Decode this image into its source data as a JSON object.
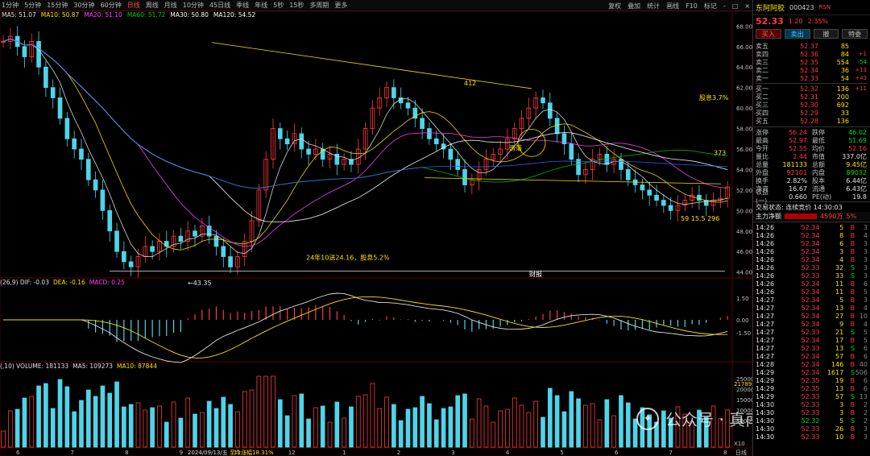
{
  "toolbar": {
    "periods": [
      "1分钟",
      "5分钟",
      "15分钟",
      "30分钟",
      "60分钟",
      "日线",
      "周线",
      "月线",
      "10分钟",
      "45日线",
      "季线",
      "年线",
      "5秒",
      "15秒",
      "多周期",
      "更多"
    ],
    "active_period": "日线",
    "right": [
      "复权",
      "叠加",
      "统计",
      "画线",
      "F10",
      "标记",
      "-",
      "□",
      "×"
    ]
  },
  "ma_legend": [
    {
      "text": "MA5: 51.07",
      "color": "#e0e0e0"
    },
    {
      "text": "MA10: 50.87",
      "color": "#ffe000"
    },
    {
      "text": "MA20: 51.10",
      "color": "#ff40ff"
    },
    {
      "text": "MA60: 51.72",
      "color": "#00d000"
    },
    {
      "text": "MA30: 50.80",
      "color": "#ffffff"
    },
    {
      "text": "MA120: 54.52",
      "color": "#ffffff"
    }
  ],
  "macd_legend": [
    {
      "text": "(26,9) DIF: -0.03",
      "color": "#e0e0e0"
    },
    {
      "text": "DEA: -0.16",
      "color": "#ffe000"
    },
    {
      "text": "MACD: 0.25",
      "color": "#ff40ff"
    }
  ],
  "vol_legend": [
    {
      "text": "(,10) VOLUME: 181133",
      "color": "#e0e0e0"
    },
    {
      "text": "MA5: 109273",
      "color": "#e0e0e0"
    },
    {
      "text": "MA10: 87844",
      "color": "#ffe000"
    }
  ],
  "chart_data": {
    "type": "candlestick",
    "price_axis": [
      "68.00",
      "66.00",
      "64.00",
      "62.00",
      "60.00",
      "58.00",
      "56.00",
      "54.00",
      "52.00",
      "50.00",
      "48.00",
      "46.00",
      "44.00"
    ],
    "price_range": [
      43.5,
      68.5
    ],
    "macd_axis": [
      "1.50",
      "0.00",
      "-1.50"
    ],
    "vol_axis": [
      "25000",
      "20000",
      "15000",
      "10000",
      "5000"
    ],
    "vol_unit": "X10",
    "vol_last_label": "21789",
    "x_labels": [
      "6",
      "7",
      "8",
      "9",
      "11",
      "12",
      "1",
      "2",
      "3",
      "4",
      "5",
      "6",
      "7",
      "8"
    ],
    "x_label_date": "2024/09/13/五",
    "x_label_extra": "至今涨幅18.31%",
    "x_axis_end": "日线",
    "annotations": {
      "high_label": "412",
      "range_label": "24年10送24.16，股息5.2%",
      "low_label": "←43.35",
      "div_label": "股息3.7%",
      "right_label": "373",
      "bottom_label": "59 15.5 296",
      "circle_label": "滑落",
      "event_marker": "财报"
    },
    "prices": [
      66.5,
      67.0,
      66.0,
      65.0,
      66.5,
      64.0,
      62.0,
      61.0,
      59.0,
      57.0,
      56.0,
      55.0,
      53.0,
      52.0,
      50.0,
      48.0,
      46.0,
      45.0,
      44.5,
      45.5,
      46.5,
      46.0,
      47.0,
      46.5,
      47.5,
      47.0,
      48.0,
      47.5,
      48.5,
      47.5,
      46.5,
      45.5,
      44.5,
      45.5,
      47.0,
      49.0,
      52.0,
      55.0,
      58.0,
      57.0,
      56.5,
      57.5,
      56.0,
      55.5,
      56.0,
      55.0,
      55.5,
      54.5,
      55.0,
      54.5,
      56.0,
      58.0,
      60.0,
      61.0,
      62.0,
      61.0,
      60.5,
      60.0,
      59.0,
      58.0,
      57.0,
      56.5,
      56.0,
      55.0,
      54.0,
      52.5,
      53.0,
      54.0,
      55.0,
      55.5,
      56.0,
      57.0,
      58.0,
      59.0,
      60.0,
      61.0,
      60.5,
      59.0,
      57.5,
      56.5,
      55.0,
      53.5,
      54.0,
      55.0,
      55.5,
      54.5,
      55.0,
      54.0,
      53.0,
      52.5,
      52.0,
      51.5,
      51.0,
      50.5,
      50.0,
      50.5,
      51.0,
      51.5,
      51.0,
      50.5,
      51.0,
      51.2,
      52.3
    ]
  },
  "panel": {
    "name": "东阿阿胶",
    "code": "000423",
    "code_tag": "RSN",
    "price": "52.33",
    "change": "1.20",
    "change_pct": "2.35%",
    "buttons": [
      "买入",
      "卖出",
      "撤",
      "特委"
    ],
    "asks": [
      {
        "label": "卖五",
        "price": "52.37",
        "vol": "85",
        "chg": ""
      },
      {
        "label": "卖四",
        "price": "52.36",
        "vol": "84",
        "chg": "+1"
      },
      {
        "label": "卖三",
        "price": "52.35",
        "vol": "554",
        "chg": "-54"
      },
      {
        "label": "卖二",
        "price": "52.34",
        "vol": "36",
        "chg": "+13"
      },
      {
        "label": "卖一",
        "price": "52.33",
        "vol": "54",
        "chg": "+43"
      }
    ],
    "bids": [
      {
        "label": "买一",
        "price": "52.32",
        "vol": "136",
        "chg": "+11"
      },
      {
        "label": "买二",
        "price": "52.31",
        "vol": "200",
        "chg": ""
      },
      {
        "label": "买三",
        "price": "52.30",
        "vol": "692",
        "chg": ""
      },
      {
        "label": "买四",
        "price": "52.29",
        "vol": "33",
        "chg": ""
      },
      {
        "label": "买五",
        "price": "52.28",
        "vol": "136",
        "chg": ""
      }
    ],
    "stats": [
      {
        "k": "涨停",
        "v": "56.24",
        "vc": "red",
        "k2": "跌停",
        "v2": "46.02",
        "v2c": "green"
      },
      {
        "k": "最高",
        "v": "52.97",
        "vc": "red",
        "k2": "最低",
        "v2": "51.69",
        "v2c": "green"
      },
      {
        "k": "今开",
        "v": "52.55",
        "vc": "red",
        "k2": "均价",
        "v2": "52.16",
        "v2c": "red"
      },
      {
        "k": "量比",
        "v": "2.44",
        "vc": "red",
        "k2": "市值",
        "v2": "337.0亿",
        "v2c": "wht"
      },
      {
        "k": "总量",
        "v": "181133",
        "vc": "yel",
        "k2": "总额",
        "v2": "9.45亿",
        "v2c": "yel"
      },
      {
        "k": "外盘",
        "v": "92101",
        "vc": "red",
        "k2": "内盘",
        "v2": "89032",
        "v2c": "green"
      },
      {
        "k": "换手",
        "v": "2.82%",
        "vc": "wht",
        "k2": "股本",
        "v2": "6.44亿",
        "v2c": "wht"
      },
      {
        "k": "净资",
        "v": "16.67",
        "vc": "wht",
        "k2": "流通",
        "v2": "6.43亿",
        "v2c": "wht"
      },
      {
        "k": "收益(一)",
        "v": "0.660",
        "vc": "wht",
        "k2": "PE(动)",
        "v2": "19.8",
        "v2c": "wht"
      }
    ],
    "status": "交易状态: 连续竞价 14:30:03",
    "fund_label": "主力净额",
    "fund_value": "4590万",
    "fund_pct": "5%",
    "ticks": [
      {
        "t": "14:26",
        "p": "52.34",
        "v": "5",
        "s": "B",
        "n": "3"
      },
      {
        "t": "14:26",
        "p": "52.34",
        "v": "8",
        "s": "B",
        "n": "4"
      },
      {
        "t": "14:26",
        "p": "52.34",
        "v": "6",
        "s": "B",
        "n": "3"
      },
      {
        "t": "14:26",
        "p": "52.34",
        "v": "3",
        "s": "B",
        "n": "3"
      },
      {
        "t": "14:26",
        "p": "52.34",
        "v": "4",
        "s": "B",
        "n": "3"
      },
      {
        "t": "14:26",
        "p": "52.33",
        "v": "32",
        "s": "S",
        "n": "3"
      },
      {
        "t": "14:26",
        "p": "52.33",
        "v": "33",
        "s": "S",
        "n": "3"
      },
      {
        "t": "14:26",
        "p": "52.34",
        "v": "11",
        "s": "B",
        "n": "6"
      },
      {
        "t": "14:26",
        "p": "52.34",
        "v": "11",
        "s": "B",
        "n": "5"
      },
      {
        "t": "14:27",
        "p": "52.34",
        "v": "5",
        "s": "B",
        "n": "3"
      },
      {
        "t": "14:27",
        "p": "52.34",
        "v": "13",
        "s": "B",
        "n": "4"
      },
      {
        "t": "14:27",
        "p": "52.34",
        "v": "27",
        "s": "B",
        "n": "10"
      },
      {
        "t": "14:27",
        "p": "52.34",
        "v": "9",
        "s": "B",
        "n": "4"
      },
      {
        "t": "14:27",
        "p": "52.33",
        "v": "21",
        "s": "S",
        "n": "5"
      },
      {
        "t": "14:27",
        "p": "52.34",
        "v": "17",
        "s": "B",
        "n": "5"
      },
      {
        "t": "14:27",
        "p": "52.33",
        "v": "13",
        "s": "S",
        "n": "6"
      },
      {
        "t": "14:27",
        "p": "52.34",
        "v": "57",
        "s": "B",
        "n": "6"
      },
      {
        "t": "14:28",
        "p": "52.34",
        "v": "146",
        "s": "B",
        "n": "40"
      },
      {
        "t": "14:29",
        "p": "52.34",
        "v": "1617",
        "s": "S",
        "n": "506"
      },
      {
        "t": "14:29",
        "p": "52.35",
        "v": "19",
        "s": "B",
        "n": "6"
      },
      {
        "t": "14:29",
        "p": "52.35",
        "v": "13",
        "s": "B",
        "n": "6"
      },
      {
        "t": "14:29",
        "p": "52.33",
        "v": "57",
        "s": "S",
        "n": "13"
      },
      {
        "t": "14:30",
        "p": "52.33",
        "v": "3",
        "s": "B",
        "n": "2"
      },
      {
        "t": "14:30",
        "p": "52.33",
        "v": "3",
        "s": "B",
        "n": "2"
      },
      {
        "t": "14:30",
        "p": "52.32",
        "v": "5",
        "s": "S",
        "n": "2"
      },
      {
        "t": "14:30",
        "p": "52.33",
        "v": "26",
        "s": "B",
        "n": "3"
      },
      {
        "t": "14:30",
        "p": "52.33",
        "v": "10",
        "s": "B",
        "n": "3"
      }
    ]
  },
  "watermark": "公众号 · 真南王"
}
